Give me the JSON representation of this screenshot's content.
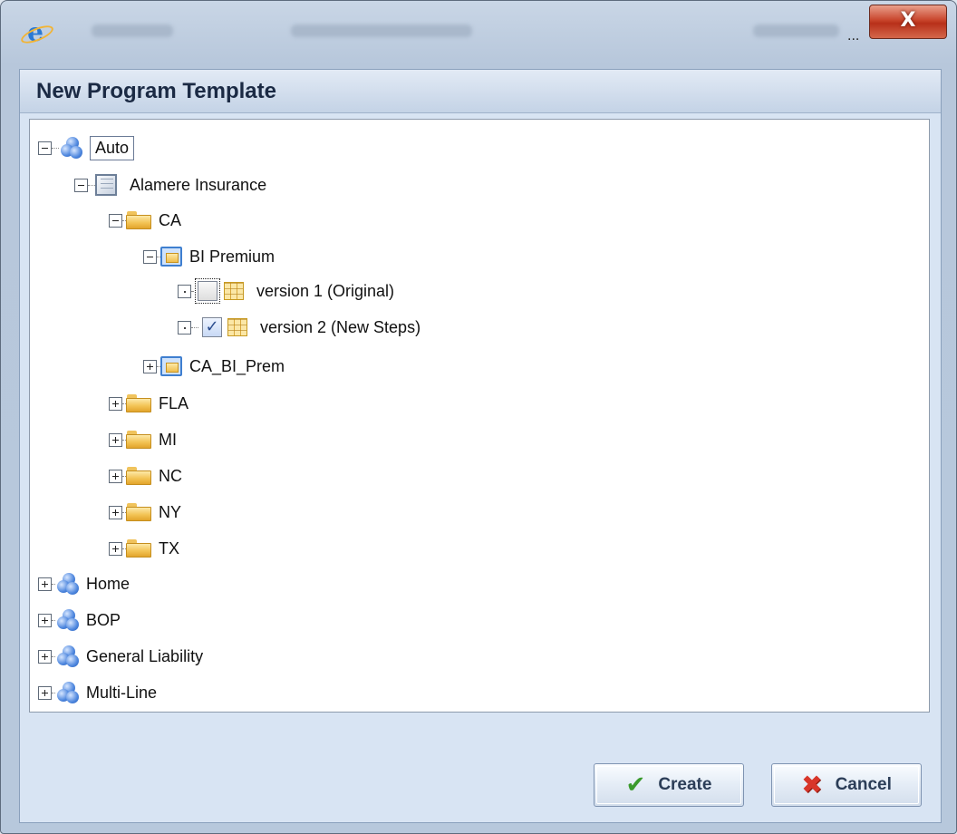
{
  "window": {
    "title_suffix": "...",
    "close_label": "X"
  },
  "dialog": {
    "title": "New Program Template"
  },
  "tree": {
    "nodes": [
      {
        "label": "Auto"
      },
      {
        "label": "Alamere Insurance"
      },
      {
        "label": "CA"
      },
      {
        "label": "BI Premium"
      },
      {
        "label": "version 1 (Original)",
        "checked": false
      },
      {
        "label": "version 2 (New Steps)",
        "checked": true
      },
      {
        "label": "CA_BI_Prem"
      },
      {
        "label": "FLA"
      },
      {
        "label": "MI"
      },
      {
        "label": "NC"
      },
      {
        "label": "NY"
      },
      {
        "label": "TX"
      },
      {
        "label": "Home"
      },
      {
        "label": "BOP"
      },
      {
        "label": "General Liability"
      },
      {
        "label": "Multi-Line"
      }
    ],
    "checkmark": "✓"
  },
  "buttons": {
    "create_label": "Create",
    "cancel_label": "Cancel",
    "create_icon": "✔",
    "cancel_icon": "✖"
  },
  "colors": {
    "accent": "#3f7fd0",
    "close": "#c8452c"
  }
}
